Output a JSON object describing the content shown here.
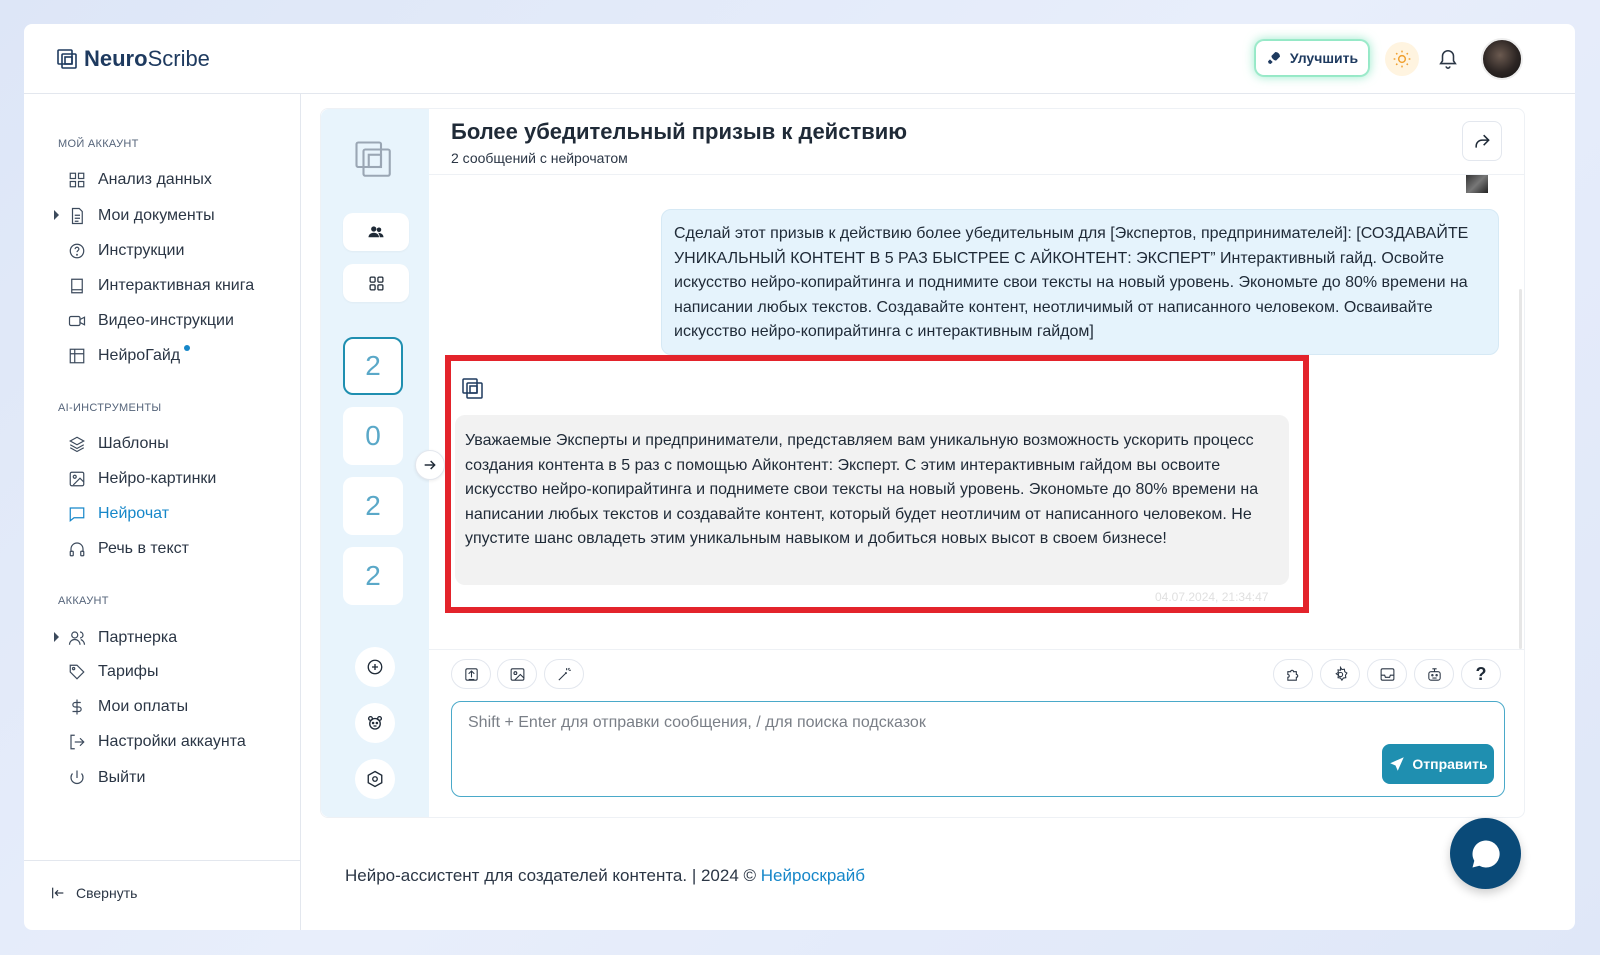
{
  "app": {
    "brand_bold": "Neuro",
    "brand_regular": "Scribe",
    "upgrade_label": "Улучшить"
  },
  "sidebar": {
    "sections": {
      "account": "МОЙ АККАУНТ",
      "ai_tools": "AI-ИНСТРУМЕНТЫ",
      "settings": "АККАУНТ"
    },
    "items": [
      {
        "label": "Анализ данных",
        "icon": "grid-icon"
      },
      {
        "label": "Мои документы",
        "icon": "document-icon"
      },
      {
        "label": "Инструкции",
        "icon": "help-circle-icon"
      },
      {
        "label": "Интерактивная книга",
        "icon": "book-icon"
      },
      {
        "label": "Видео-инструкции",
        "icon": "video-icon"
      },
      {
        "label": "НейроГайд",
        "icon": "table-icon"
      },
      {
        "label": "Шаблоны",
        "icon": "layers-icon"
      },
      {
        "label": "Нейро-картинки",
        "icon": "image-icon"
      },
      {
        "label": "Нейрочат",
        "icon": "chat-icon",
        "active": true
      },
      {
        "label": "Речь в текст",
        "icon": "headphones-icon"
      },
      {
        "label": "Партнерка",
        "icon": "users-icon"
      },
      {
        "label": "Тарифы",
        "icon": "tag-icon"
      },
      {
        "label": "Мои оплаты",
        "icon": "dollar-icon"
      },
      {
        "label": "Настройки аккаунта",
        "icon": "logout-arrow-icon"
      },
      {
        "label": "Выйти",
        "icon": "power-icon"
      }
    ],
    "collapse_label": "Свернуть"
  },
  "rail": {
    "counts": [
      "2",
      "0",
      "2",
      "2"
    ]
  },
  "chat": {
    "title": "Более убедительный призыв к действию",
    "subtitle": "2 сообщений с нейрочатом",
    "user_message": "Сделай этот призыв к действию более убедительным для [Экспертов, предпринимателей]: [СОЗДАВАЙТЕ УНИКАЛЬНЫЙ КОНТЕНТ В 5 РАЗ БЫСТРЕЕ С АЙКОНТЕНТ: ЭКСПЕРТ” Интерактивный гайд. Освойте искусство нейро-копирайтинга и поднимите свои тексты на новый уровень. Экономьте до 80% времени на написании любых текстов. Создавайте контент, неотличимый от написанного человеком. Осваивайте искусство нейро-копирайтинга с интерактивным гайдом]",
    "bot_message": "Уважаемые Эксперты и предприниматели, представляем вам уникальную возможность ускорить процесс создания контента в 5 раз с помощью Айконтент: Эксперт. С этим интерактивным гайдом вы освоите искусство нейро-копирайтинга и поднимете свои тексты на новый уровень. Экономьте до 80% времени на написании любых текстов и создавайте контент, который будет неотличим от написанного человеком. Не упустите шанс овладеть этим уникальным навыком и добиться новых высот в своем бизнесе!",
    "bot_timestamp": "04.07.2024, 21:34:47",
    "input_placeholder": "Shift + Enter для отправки сообщения, / для поиска подсказок",
    "send_label": "Отправить",
    "help_glyph": "?"
  },
  "footer": {
    "text": "Нейро-ассистент для создателей контента.  | 2024 © ",
    "link": "Нейроскрайб"
  },
  "colors": {
    "accent": "#1f8fb0",
    "active_nav": "#1687c9",
    "highlight": "#e3232b",
    "fab": "#0a4a78"
  }
}
